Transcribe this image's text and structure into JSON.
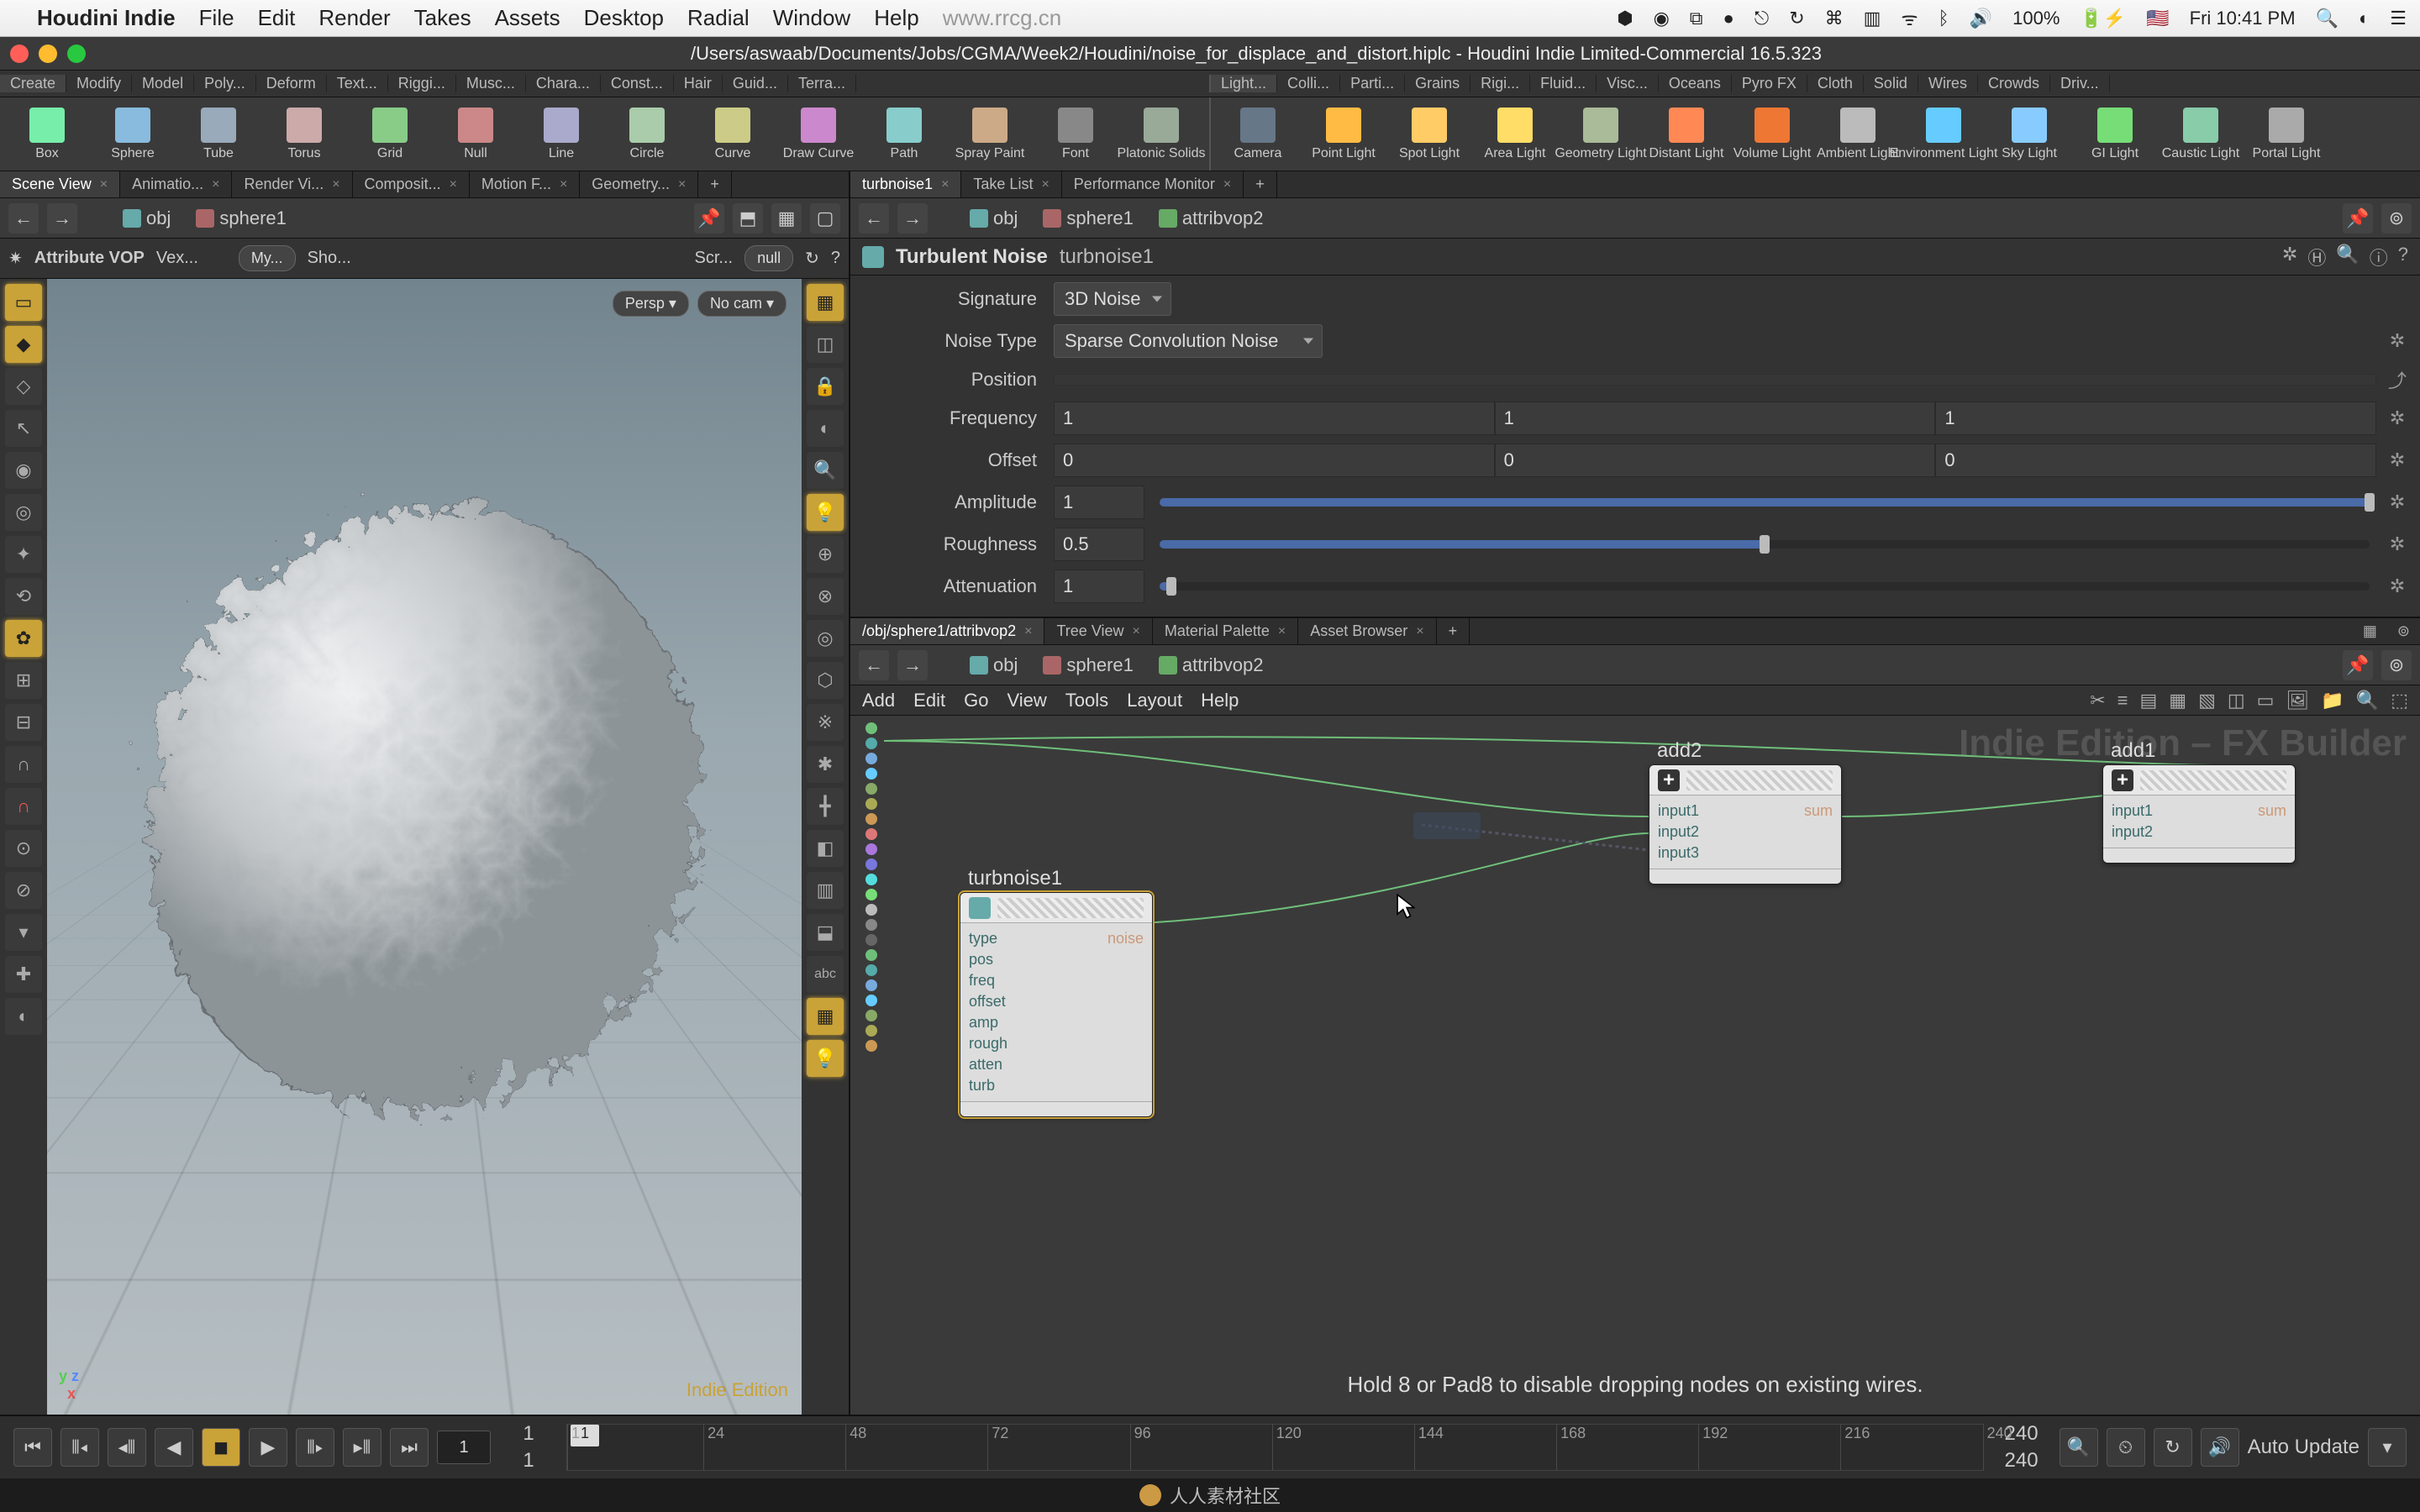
{
  "menubar": {
    "apple": "",
    "app": "Houdini Indie",
    "items": [
      "File",
      "Edit",
      "Render",
      "Takes",
      "Assets",
      "Desktop",
      "Radial",
      "Window",
      "Help"
    ],
    "url": "www.rrcg.cn",
    "right": {
      "battery": "100%",
      "clock": "Fri 10:41 PM"
    }
  },
  "window": {
    "title": "/Users/aswaab/Documents/Jobs/CGMA/Week2/Houdini/noise_for_displace_and_distort.hiplc - Houdini Indie Limited-Commercial 16.5.323"
  },
  "shelf_tabs_left": [
    "Create",
    "Modify",
    "Model",
    "Poly...",
    "Deform",
    "Text...",
    "Riggi...",
    "Musc...",
    "Chara...",
    "Const...",
    "Hair",
    "Guid...",
    "Terra..."
  ],
  "shelf_tabs_right": [
    "Light...",
    "Colli...",
    "Parti...",
    "Grains",
    "Rigi...",
    "Fluid...",
    "Visc...",
    "Oceans",
    "Pyro FX",
    "Cloth",
    "Solid",
    "Wires",
    "Crowds",
    "Driv..."
  ],
  "shelf_tools_left": [
    {
      "l": "Box",
      "c": "#7ea"
    },
    {
      "l": "Sphere",
      "c": "#8bd"
    },
    {
      "l": "Tube",
      "c": "#9ab"
    },
    {
      "l": "Torus",
      "c": "#caa"
    },
    {
      "l": "Grid",
      "c": "#8c8"
    },
    {
      "l": "Null",
      "c": "#c88"
    },
    {
      "l": "Line",
      "c": "#aac"
    },
    {
      "l": "Circle",
      "c": "#aca"
    },
    {
      "l": "Curve",
      "c": "#cc8"
    },
    {
      "l": "Draw Curve",
      "c": "#c8c"
    },
    {
      "l": "Path",
      "c": "#8cc"
    },
    {
      "l": "Spray Paint",
      "c": "#ca8"
    },
    {
      "l": "Font",
      "c": "#888"
    },
    {
      "l": "Platonic Solids",
      "c": "#9a9"
    }
  ],
  "shelf_tools_right": [
    {
      "l": "Camera",
      "c": "#678"
    },
    {
      "l": "Point Light",
      "c": "#fb4"
    },
    {
      "l": "Spot Light",
      "c": "#fc6"
    },
    {
      "l": "Area Light",
      "c": "#fd6"
    },
    {
      "l": "Geometry Light",
      "c": "#ab9"
    },
    {
      "l": "Distant Light",
      "c": "#f85"
    },
    {
      "l": "Volume Light",
      "c": "#e73"
    },
    {
      "l": "Ambient Light",
      "c": "#bbb"
    },
    {
      "l": "Environment Light",
      "c": "#6cf"
    },
    {
      "l": "Sky Light",
      "c": "#8cf"
    },
    {
      "l": "GI Light",
      "c": "#7d7"
    },
    {
      "l": "Caustic Light",
      "c": "#8ca"
    },
    {
      "l": "Portal Light",
      "c": "#aaa"
    }
  ],
  "left_tabs": [
    "Scene View",
    "Animatio...",
    "Render Vi...",
    "Composit...",
    "Motion F...",
    "Geometry..."
  ],
  "left_path": {
    "obj": "obj",
    "node": "sphere1"
  },
  "view_toolbar": {
    "label": "Attribute VOP",
    "vex": "Vex...",
    "my": "My...",
    "sho": "Sho...",
    "scr": "Scr...",
    "null": "null"
  },
  "vp": {
    "persp": "Persp ▾",
    "nocam": "No cam ▾",
    "indie": "Indie Edition"
  },
  "parm_tabs": [
    "turbnoise1",
    "Take List",
    "Performance Monitor"
  ],
  "parm_path": {
    "obj": "obj",
    "n1": "sphere1",
    "n2": "attribvop2"
  },
  "parm_header": {
    "type": "Turbulent Noise",
    "name": "turbnoise1"
  },
  "parms": {
    "signature": {
      "label": "Signature",
      "value": "3D Noise"
    },
    "noisetype": {
      "label": "Noise Type",
      "value": "Sparse Convolution Noise"
    },
    "position": {
      "label": "Position"
    },
    "frequency": {
      "label": "Frequency",
      "v": [
        "1",
        "1",
        "1"
      ]
    },
    "offset": {
      "label": "Offset",
      "v": [
        "0",
        "0",
        "0"
      ]
    },
    "amplitude": {
      "label": "Amplitude",
      "v": "1",
      "p": 100
    },
    "roughness": {
      "label": "Roughness",
      "v": "0.5",
      "p": 50
    },
    "attenuation": {
      "label": "Attenuation",
      "v": "1",
      "p": 0
    }
  },
  "net_tabs": [
    "/obj/sphere1/attribvop2",
    "Tree View",
    "Material Palette",
    "Asset Browser"
  ],
  "net_path": {
    "obj": "obj",
    "n1": "sphere1",
    "n2": "attribvop2"
  },
  "net_menu": [
    "Add",
    "Edit",
    "Go",
    "View",
    "Tools",
    "Layout",
    "Help"
  ],
  "net_watermark": "Indie Edition – FX Builder",
  "nodes": {
    "turb": {
      "label": "turbnoise1",
      "ports": [
        "type",
        "pos",
        "freq",
        "offset",
        "amp",
        "rough",
        "atten",
        "turb"
      ],
      "out": "noise"
    },
    "add2": {
      "label": "add2",
      "ports": [
        "input1",
        "input2",
        "input3"
      ],
      "out": "sum"
    },
    "add1": {
      "label": "add1",
      "ports": [
        "input1",
        "input2"
      ],
      "out": "sum"
    }
  },
  "net_hint": "Hold 8 or Pad8 to disable dropping nodes on existing wires.",
  "timeline": {
    "cur": "1",
    "start": "1",
    "end": "240",
    "ticks": [
      1,
      24,
      48,
      72,
      96,
      120,
      144,
      168,
      192,
      216,
      240
    ],
    "auto": "Auto Update"
  },
  "footer": "人人素材社区"
}
